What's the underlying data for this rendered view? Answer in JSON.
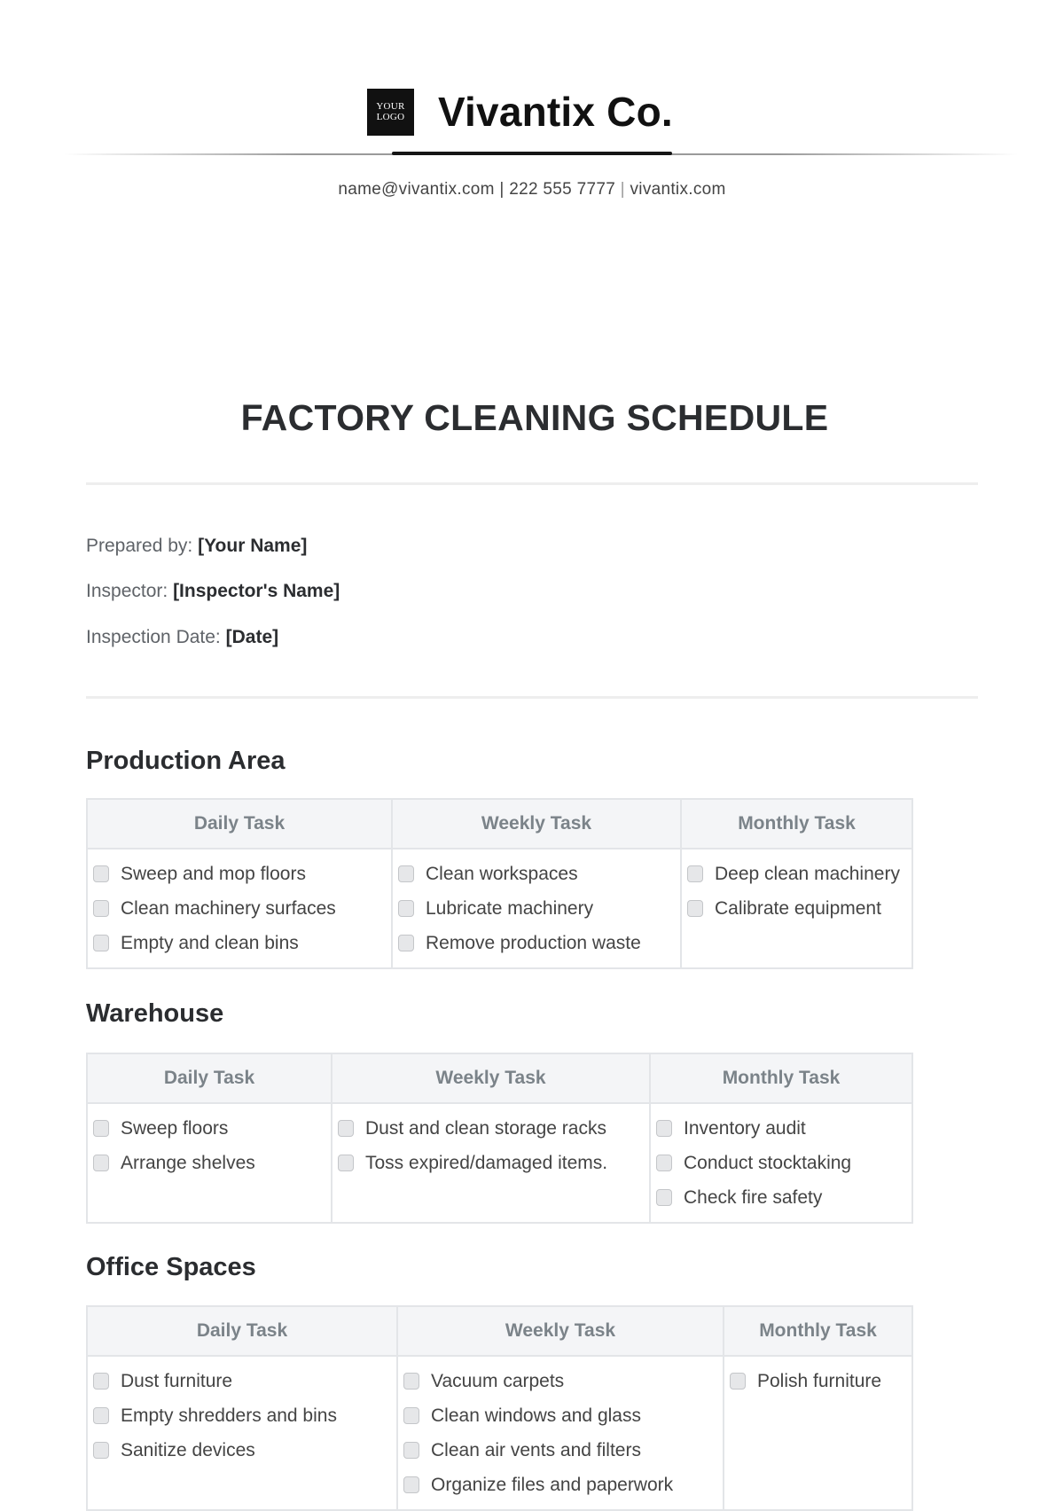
{
  "header": {
    "logo_line1": "YOUR",
    "logo_line2": "LOGO",
    "company_name": "Vivantix Co.",
    "contact_email": "name@vivantix.com",
    "contact_phone": "222 555 7777",
    "contact_website": "vivantix.com",
    "separator": "|"
  },
  "document": {
    "title": "FACTORY CLEANING SCHEDULE",
    "meta": [
      {
        "label": "Prepared by:",
        "value": "[Your Name]"
      },
      {
        "label": "Inspector:",
        "value": "[Inspector's Name]"
      },
      {
        "label": "Inspection Date:",
        "value": "[Date]"
      }
    ]
  },
  "columns": [
    "Daily Task",
    "Weekly Task",
    "Monthly Task"
  ],
  "sections": [
    {
      "title": "Production Area",
      "daily": [
        "Sweep and mop floors",
        "Clean machinery surfaces",
        "Empty and clean bins"
      ],
      "weekly": [
        "Clean workspaces",
        "Lubricate machinery",
        "Remove production waste"
      ],
      "monthly": [
        "Deep clean machinery",
        "Calibrate equipment"
      ]
    },
    {
      "title": "Warehouse",
      "daily": [
        "Sweep floors",
        "Arrange shelves"
      ],
      "weekly": [
        "Dust and clean storage racks",
        "Toss expired/damaged items."
      ],
      "monthly": [
        "Inventory audit",
        "Conduct stocktaking",
        "Check fire safety"
      ]
    },
    {
      "title": "Office Spaces",
      "daily": [
        "Dust furniture",
        "Empty shredders and bins",
        "Sanitize devices"
      ],
      "weekly": [
        "Vacuum carpets",
        "Clean windows and glass",
        "Clean air vents and filters",
        "Organize files and paperwork"
      ],
      "monthly": [
        "Polish furniture"
      ]
    }
  ],
  "colors": {
    "text": "#2b2d30",
    "header_bg": "#f4f5f7",
    "header_text": "#7b8389",
    "border": "#e3e5e8",
    "checkbox_fill": "#e6e7e9"
  }
}
